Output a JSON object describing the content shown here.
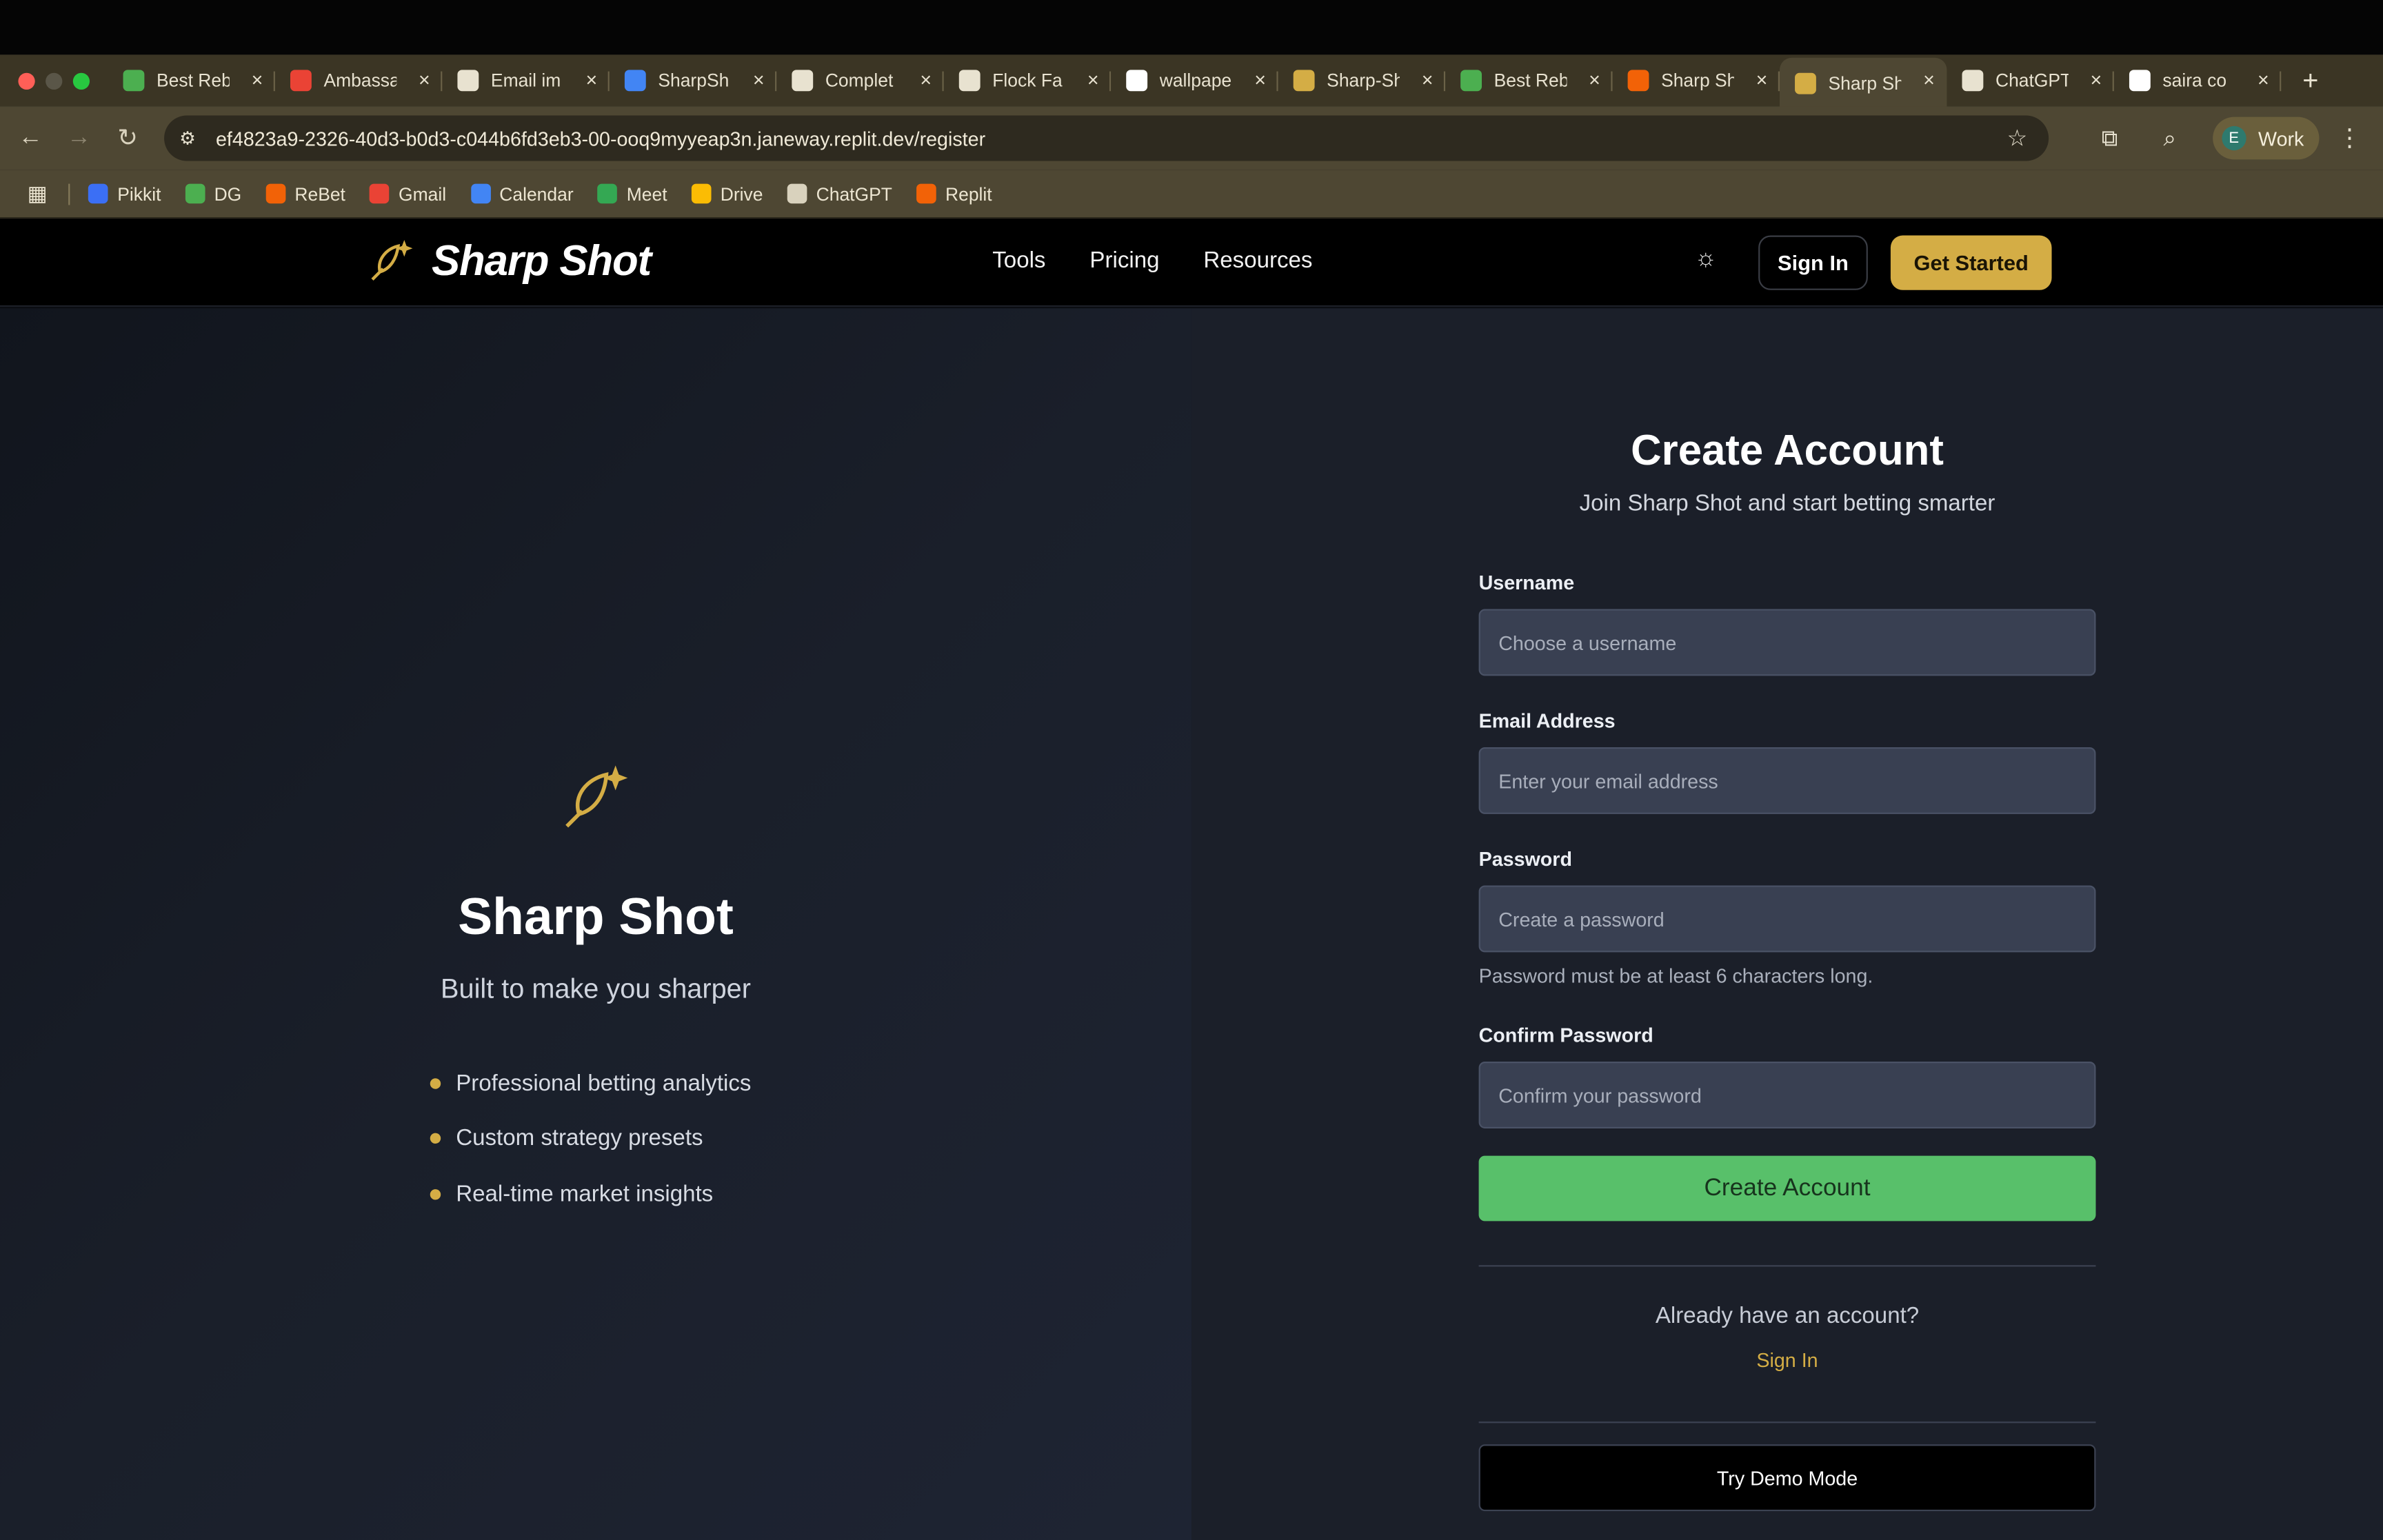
{
  "browser": {
    "tabs": [
      {
        "label": "Best Reb",
        "icon": "link-icon",
        "color": "#4caf50"
      },
      {
        "label": "Ambassa",
        "icon": "gmail-icon",
        "color": "#ea4335"
      },
      {
        "label": "Email im",
        "icon": "chatgpt-icon",
        "color": "#e8e2d0"
      },
      {
        "label": "SharpSh",
        "icon": "calendar-icon",
        "color": "#4285f4"
      },
      {
        "label": "Complet",
        "icon": "github-icon",
        "color": "#e8e2d0"
      },
      {
        "label": "Flock Fa",
        "icon": "flock-icon",
        "color": "#e8e2d0"
      },
      {
        "label": "wallpape",
        "icon": "google-icon",
        "color": "#ffffff"
      },
      {
        "label": "Sharp-Sh",
        "icon": "sharpshot-icon",
        "color": "#d4ad45"
      },
      {
        "label": "Best Reb",
        "icon": "link-icon",
        "color": "#4caf50"
      },
      {
        "label": "Sharp Sh",
        "icon": "replit-icon",
        "color": "#f26207"
      },
      {
        "label": "Sharp Sh",
        "icon": "sharpshot-icon",
        "color": "#d4ad45",
        "active": true
      },
      {
        "label": "ChatGPT",
        "icon": "chatgpt-icon",
        "color": "#e8e2d0"
      },
      {
        "label": "saira co",
        "icon": "google-icon",
        "color": "#ffffff"
      }
    ],
    "url": "ef4823a9-2326-40d3-b0d3-c044b6fd3eb3-00-ooq9myyeap3n.janeway.replit.dev/register",
    "profile": {
      "initial": "E",
      "label": "Work"
    },
    "bookmarks": [
      {
        "label": "Pikkit",
        "color": "#3b6ff5"
      },
      {
        "label": "DG",
        "color": "#4caf50"
      },
      {
        "label": "ReBet",
        "color": "#f26207"
      },
      {
        "label": "Gmail",
        "color": "#ea4335"
      },
      {
        "label": "Calendar",
        "color": "#4285f4"
      },
      {
        "label": "Meet",
        "color": "#34a853"
      },
      {
        "label": "Drive",
        "color": "#fbbc04"
      },
      {
        "label": "ChatGPT",
        "color": "#d9d2bd"
      },
      {
        "label": "Replit",
        "color": "#f26207"
      }
    ]
  },
  "header": {
    "brand": "Sharp Shot",
    "nav": [
      "Tools",
      "Pricing",
      "Resources"
    ],
    "sign_in": "Sign In",
    "get_started": "Get Started"
  },
  "hero": {
    "title": "Sharp Shot",
    "subtitle": "Built to make you sharper",
    "features": [
      "Professional betting analytics",
      "Custom strategy presets",
      "Real-time market insights"
    ]
  },
  "form": {
    "title": "Create Account",
    "subtitle": "Join Sharp Shot and start betting smarter",
    "username_label": "Username",
    "username_placeholder": "Choose a username",
    "email_label": "Email Address",
    "email_placeholder": "Enter your email address",
    "password_label": "Password",
    "password_placeholder": "Create a password",
    "password_hint": "Password must be at least 6 characters long.",
    "confirm_label": "Confirm Password",
    "confirm_placeholder": "Confirm your password",
    "submit": "Create Account",
    "already": "Already have an account?",
    "sign_in_link": "Sign In",
    "demo": "Try Demo Mode"
  },
  "colors": {
    "accent_gold": "#d4ad45",
    "submit_green": "#58c06a"
  }
}
